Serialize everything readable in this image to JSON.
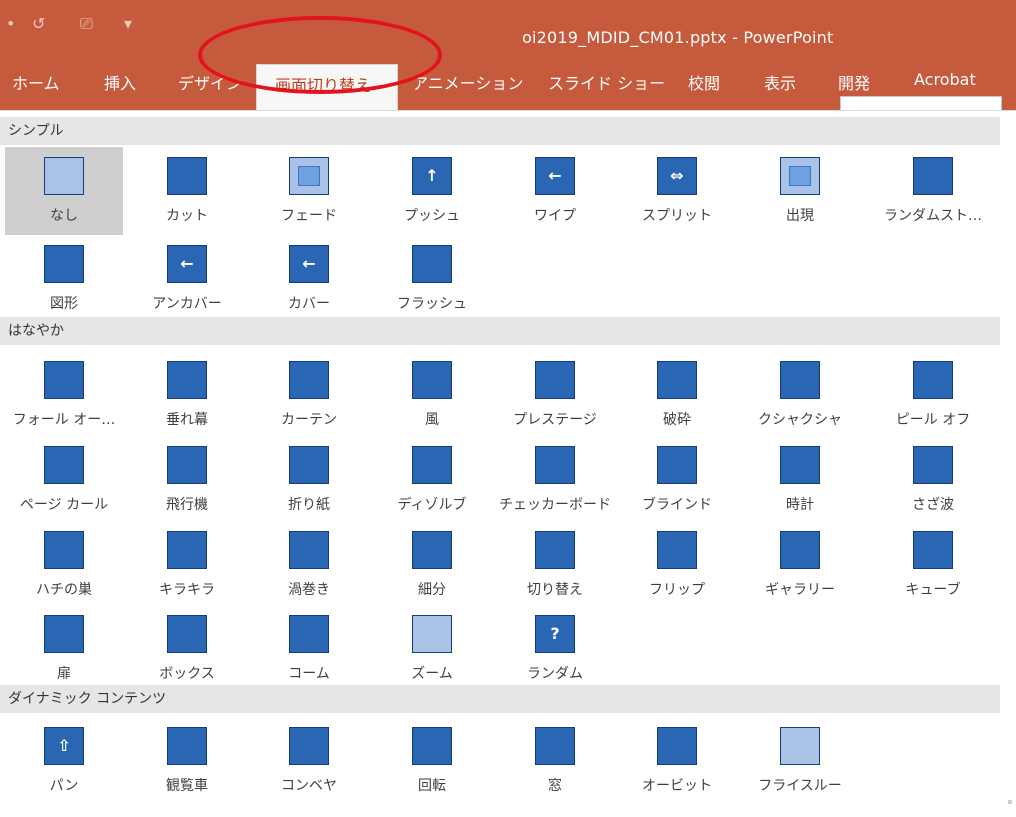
{
  "titlebar": {
    "qat_undo": "•",
    "qat_redo": "↺",
    "qat_present": "⎚",
    "qat_more": "▾",
    "window_title": "oi2019_MDID_CM01.pptx - PowerPoint"
  },
  "ribbon": {
    "tabs": [
      "ホーム",
      "挿入",
      "デザイン",
      "画面切り替え",
      "アニメーション",
      "スライド ショー",
      "校閲",
      "表示",
      "開発",
      "Acrobat"
    ],
    "active_tab": "画面切り替え"
  },
  "gallery": {
    "sections": [
      {
        "title": "シンプル",
        "items": [
          "なし",
          "カット",
          "フェード",
          "プッシュ",
          "ワイプ",
          "スプリット",
          "出現",
          "ランダムスト…",
          "図形",
          "アンカバー",
          "カバー",
          "フラッシュ"
        ]
      },
      {
        "title": "はなやか",
        "items": [
          "フォール オー…",
          "垂れ幕",
          "カーテン",
          "風",
          "プレステージ",
          "破砕",
          "クシャクシャ",
          "ピール オフ",
          "ページ カール",
          "飛行機",
          "折り紙",
          "ディゾルブ",
          "チェッカーボード",
          "ブラインド",
          "時計",
          "さざ波",
          "ハチの巣",
          "キラキラ",
          "渦巻き",
          "細分",
          "切り替え",
          "フリップ",
          "ギャラリー",
          "キューブ",
          "扉",
          "ボックス",
          "コーム",
          "ズーム",
          "ランダム"
        ]
      },
      {
        "title": "ダイナミック コンテンツ",
        "items": [
          "パン",
          "観覧車",
          "コンベヤ",
          "回転",
          "窓",
          "オービット",
          "フライスルー"
        ]
      }
    ],
    "selected_item": "なし",
    "glyphs": {
      "push": "↑",
      "wipe": "←",
      "split": "⇔",
      "uncover": "←",
      "cover": "←",
      "random": "?",
      "pan": "⇧"
    }
  },
  "colors": {
    "accent": "#c55a3d",
    "active_tab_text": "#c43e1c",
    "highlight_ellipse": "#e3121b",
    "thumb_blue": "#2b66b5"
  }
}
